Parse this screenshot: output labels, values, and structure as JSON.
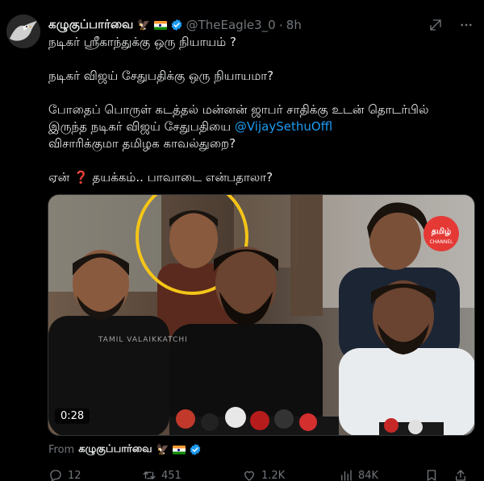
{
  "author": {
    "display_name": "கழுகுப்பார்வை",
    "badge_emoji": "🦅",
    "handle": "@TheEagle3_0",
    "time": "8h",
    "verified": true
  },
  "tweet": {
    "line1": "நடிகர் ஸ்ரீகாந்துக்கு ஒரு நியாயம் ?",
    "line2": "நடிகர் விஜய் சேதுபதிக்கு ஒரு நியாயமா?",
    "line3a": "போதைப் பொருள் கடத்தல் மன்னன் ஜாபர் சாதிக்கு உடன் தொடர்பில் இருந்த நடிகர் விஜய் சேதுபதியை ",
    "mention": "@VijaySethuOffl",
    "line3b": "விசாரிக்குமா தமிழக காவல்துறை?",
    "line4a": "ஏன்",
    "line4_emoji": "❓",
    "line4b": " தயக்கம்.. பாவாடை என்பதாலா?"
  },
  "media": {
    "timestamp": "0:28",
    "watermark": "TAMIL VALAIKKATCHI",
    "logo_text": "தமிழ்",
    "logo_sub": "CHANNEL"
  },
  "from": {
    "label": "From",
    "name": "கழுகுப்பார்வை",
    "badge_emoji": "🦅"
  },
  "actions": {
    "replies": "12",
    "retweets": "451",
    "likes": "1.2K",
    "views": "84K"
  },
  "colors": {
    "background": "#000000",
    "text": "#e7e9ea",
    "muted": "#71767b",
    "accent": "#1d9bf0",
    "highlight_ring": "#f5c518"
  },
  "icons": {
    "header": [
      "grok-icon",
      "more-icon"
    ],
    "actions": [
      "reply-icon",
      "retweet-icon",
      "like-icon",
      "views-icon",
      "bookmark-icon",
      "share-icon"
    ]
  }
}
